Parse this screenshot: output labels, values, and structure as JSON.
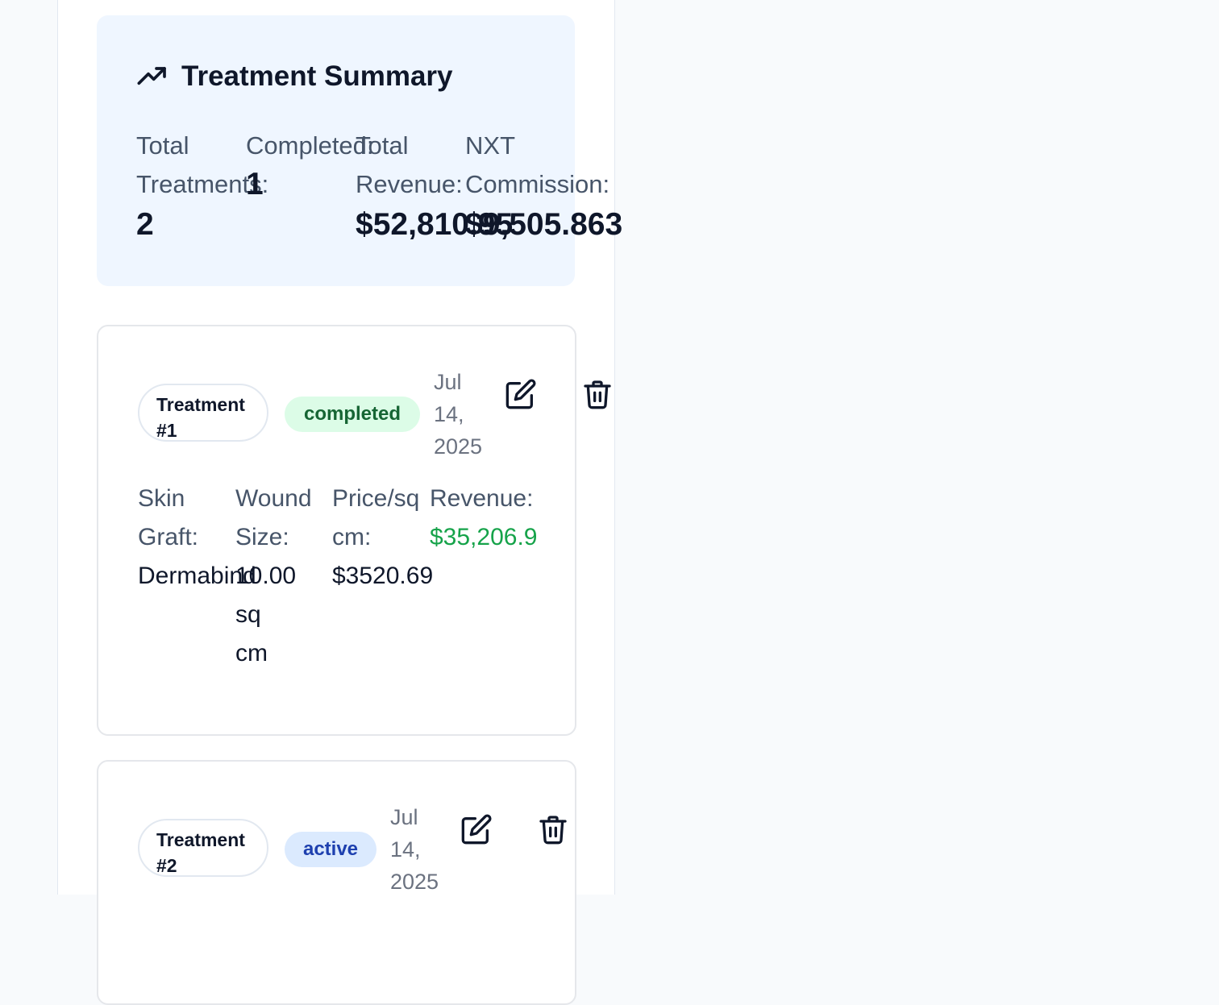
{
  "colors": {
    "summary_background": "#eff6ff",
    "completed_badge_bg": "#dcfce7",
    "completed_badge_text": "#166534",
    "active_badge_bg": "#dbeafe",
    "active_badge_text": "#1e40af",
    "revenue_green": "#16a34a"
  },
  "summary": {
    "icon": "trending-up-icon",
    "title": "Treatment Summary",
    "stats": [
      {
        "label_line1": "Total",
        "label_line2": "Treatments:",
        "value": "2"
      },
      {
        "label_line1": "Completed:",
        "label_line2": "",
        "value": "1"
      },
      {
        "label_line1": "Total",
        "label_line2": "Revenue:",
        "value": "$52,810.95"
      },
      {
        "label_line1": "NXT",
        "label_line2": "Commission:",
        "value": "$9,505.863"
      }
    ]
  },
  "treatments": [
    {
      "tag_line1": "Treatment",
      "tag_line2": "#1",
      "status": "completed",
      "date_line1": "Jul",
      "date_line2": "14,",
      "date_line3": "2025",
      "edit_icon": "edit-icon",
      "delete_icon": "trash-icon",
      "fields": {
        "skin_graft_label_1": "Skin",
        "skin_graft_label_2": "Graft:",
        "skin_graft_value": "Dermabind",
        "wound_size_label_1": "Wound",
        "wound_size_label_2": "Size:",
        "wound_size_value_1": "10.00",
        "wound_size_value_2": "sq",
        "wound_size_value_3": "cm",
        "price_label_1": "Price/sq",
        "price_label_2": "cm:",
        "price_value": "$3520.69",
        "revenue_label": "Revenue:",
        "revenue_value": "$35,206.9"
      }
    },
    {
      "tag_line1": "Treatment",
      "tag_line2": "#2",
      "status": "active",
      "date_line1": "Jul",
      "date_line2": "14,",
      "date_line3": "2025",
      "edit_icon": "edit-icon",
      "delete_icon": "trash-icon"
    }
  ]
}
